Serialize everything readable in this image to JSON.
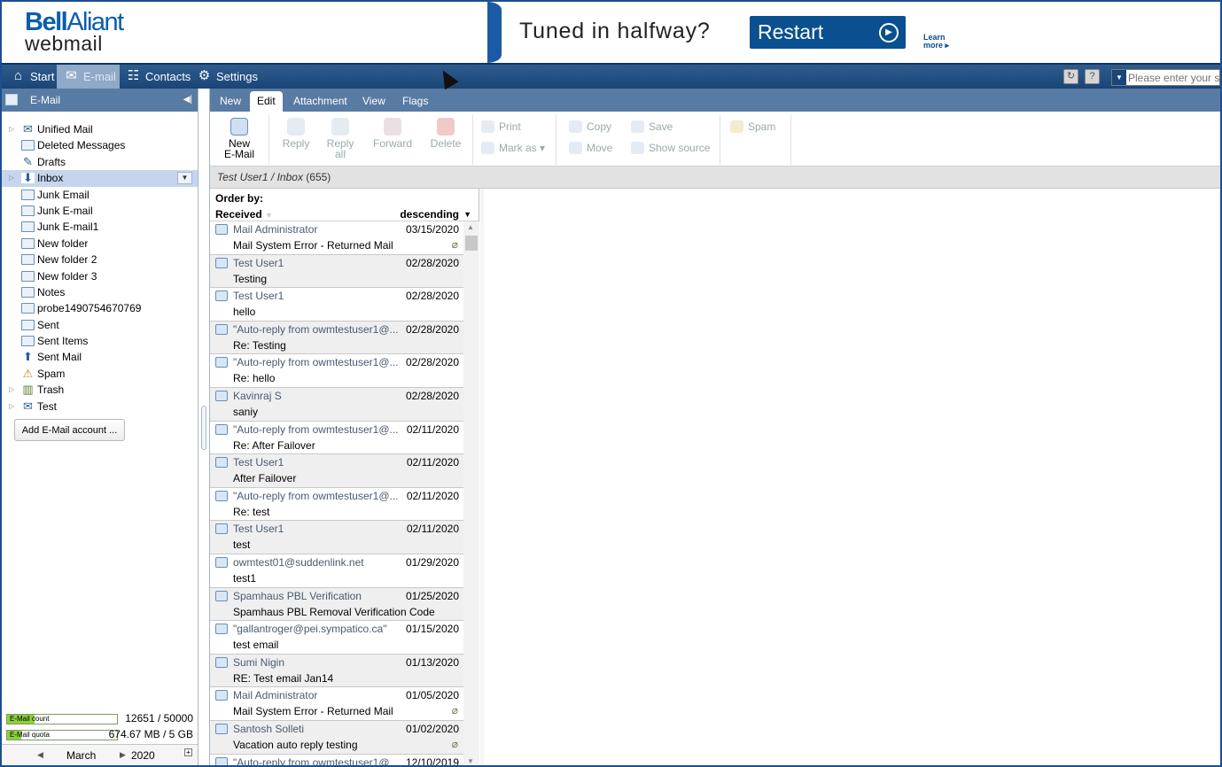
{
  "header": {
    "brand_bell": "Bell",
    "brand_aliant": "Aliant",
    "brand_sub": "webmail",
    "ad_headline": "Tuned in halfway?",
    "ad_button": "Restart",
    "ad_learn_1": "Learn",
    "ad_learn_2": "more ▸"
  },
  "nav": {
    "start": "Start",
    "email": "E-mail",
    "contacts": "Contacts",
    "settings": "Settings",
    "search_placeholder": "Please enter your s"
  },
  "sidebar": {
    "title": "E-Mail",
    "folders": [
      {
        "label": "Unified Mail",
        "icon": "unified-mail-icon",
        "expandable": true
      },
      {
        "label": "Deleted Messages",
        "icon": "folder-icon"
      },
      {
        "label": "Drafts",
        "icon": "drafts-icon"
      },
      {
        "label": "Inbox",
        "icon": "inbox-icon",
        "expandable": true,
        "selected": true
      },
      {
        "label": "Junk Email",
        "icon": "folder-icon"
      },
      {
        "label": "Junk E-mail",
        "icon": "folder-icon"
      },
      {
        "label": "Junk E-mail1",
        "icon": "folder-icon"
      },
      {
        "label": "New folder",
        "icon": "folder-icon"
      },
      {
        "label": "New folder 2",
        "icon": "folder-icon"
      },
      {
        "label": "New folder 3",
        "icon": "folder-icon"
      },
      {
        "label": "Notes",
        "icon": "folder-icon"
      },
      {
        "label": "probe1490754670769",
        "icon": "folder-icon"
      },
      {
        "label": "Sent",
        "icon": "folder-icon"
      },
      {
        "label": "Sent Items",
        "icon": "folder-icon"
      },
      {
        "label": "Sent Mail",
        "icon": "sent-mail-icon"
      },
      {
        "label": "Spam",
        "icon": "spam-icon"
      },
      {
        "label": "Trash",
        "icon": "trash-icon",
        "expandable": true
      },
      {
        "label": "Test",
        "icon": "unified-mail-icon",
        "expandable": true
      }
    ],
    "add_account": "Add E-Mail account ...",
    "quota": {
      "count_label": "E-Mail count",
      "count_value": "12651 / 50000",
      "count_fraction": 0.253,
      "size_label": "E-Mail quota",
      "size_value": "674.67 MB / 5 GB",
      "size_fraction": 0.132
    },
    "calendar": {
      "month": "March",
      "year": "2020"
    }
  },
  "ribbon": {
    "tabs": [
      "New",
      "Edit",
      "Attachment",
      "View",
      "Flags"
    ],
    "active_tab": "Edit",
    "new_email_1": "New",
    "new_email_2": "E-Mail",
    "reply": "Reply",
    "reply_all_1": "Reply",
    "reply_all_2": "all",
    "forward": "Forward",
    "delete": "Delete",
    "print": "Print",
    "mark_as": "Mark as ▾",
    "copy": "Copy",
    "move": "Move",
    "save": "Save",
    "show_source": "Show source",
    "spam": "Spam"
  },
  "breadcrumb": {
    "path": "Test User1 / Inbox",
    "count": "(655)"
  },
  "list": {
    "order_by": "Order by:",
    "sort_key": "Received",
    "sort_dir": "descending",
    "messages": [
      {
        "from": "Mail Administrator",
        "date": "03/15/2020",
        "subject": "Mail System Error - Returned Mail",
        "attachment": true
      },
      {
        "from": "Test User1",
        "date": "02/28/2020",
        "subject": "Testing"
      },
      {
        "from": "Test User1",
        "date": "02/28/2020",
        "subject": "hello"
      },
      {
        "from": "\"Auto-reply from owmtestuser1@...",
        "date": "02/28/2020",
        "subject": "Re: Testing"
      },
      {
        "from": "\"Auto-reply from owmtestuser1@...",
        "date": "02/28/2020",
        "subject": "Re: hello"
      },
      {
        "from": "Kavinraj S",
        "date": "02/28/2020",
        "subject": "saniy"
      },
      {
        "from": "\"Auto-reply from owmtestuser1@...",
        "date": "02/11/2020",
        "subject": "Re: After Failover"
      },
      {
        "from": "Test User1",
        "date": "02/11/2020",
        "subject": "After Failover"
      },
      {
        "from": "\"Auto-reply from owmtestuser1@...",
        "date": "02/11/2020",
        "subject": "Re: test"
      },
      {
        "from": "Test User1",
        "date": "02/11/2020",
        "subject": "test"
      },
      {
        "from": "owmtest01@suddenlink.net",
        "date": "01/29/2020",
        "subject": "test1"
      },
      {
        "from": "Spamhaus PBL Verification",
        "date": "01/25/2020",
        "subject": "Spamhaus PBL Removal Verification Code"
      },
      {
        "from": "\"gallantroger@pei.sympatico.ca\"",
        "date": "01/15/2020",
        "subject": "test email"
      },
      {
        "from": "Sumi Nigin",
        "date": "01/13/2020",
        "subject": "RE: Test email Jan14"
      },
      {
        "from": "Mail Administrator",
        "date": "01/05/2020",
        "subject": "Mail System Error - Returned Mail",
        "attachment": true
      },
      {
        "from": "Santosh Solleti",
        "date": "01/02/2020",
        "subject": "Vacation auto reply testing",
        "attachment": true
      },
      {
        "from": "\"Auto-reply from owmtestuser1@...",
        "date": "12/10/2019",
        "subject": ""
      }
    ]
  }
}
